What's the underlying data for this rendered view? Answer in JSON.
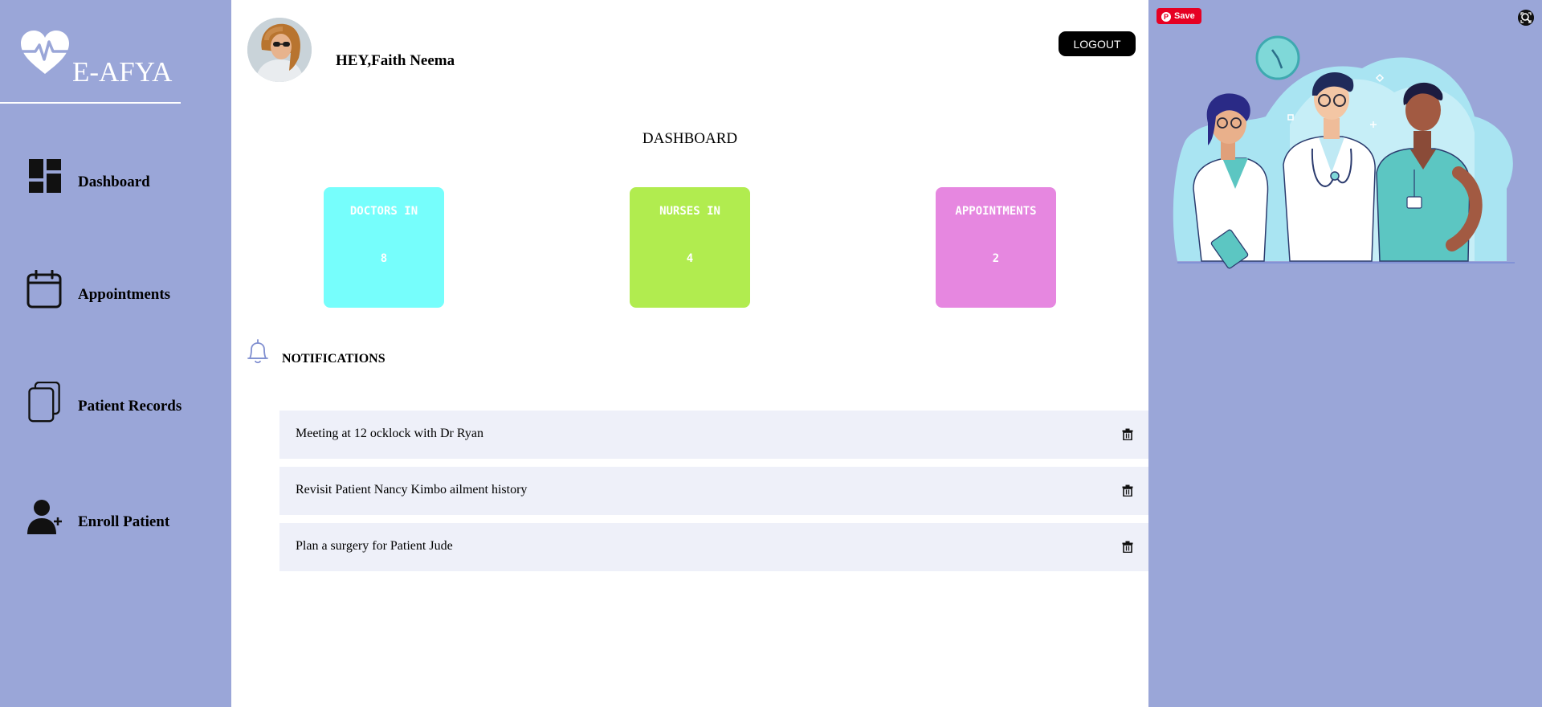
{
  "brand": {
    "name": "E-AFYA"
  },
  "sidebar": {
    "items": [
      {
        "label": "Dashboard",
        "icon": "dashboard-icon"
      },
      {
        "label": "Appointments",
        "icon": "calendar-icon"
      },
      {
        "label": "Patient Records",
        "icon": "records-icon"
      },
      {
        "label": "Enroll Patient",
        "icon": "add-user-icon"
      }
    ]
  },
  "header": {
    "greeting": "HEY,Faith Neema",
    "logout_label": "LOGOUT"
  },
  "dashboard": {
    "title": "DASHBOARD",
    "stats": [
      {
        "label": "DOCTORS IN",
        "value": "8",
        "color": "#76fefc"
      },
      {
        "label": "NURSES IN",
        "value": "4",
        "color": "#b1ec4f"
      },
      {
        "label": "APPOINTMENTS",
        "value": "2",
        "color": "#e687e0"
      }
    ]
  },
  "notifications": {
    "title": "NOTIFICATIONS",
    "items": [
      {
        "text": "Meeting at 12 ocklock with Dr Ryan"
      },
      {
        "text": "Revisit Patient Nancy Kimbo ailment history"
      },
      {
        "text": "Plan a surgery for Patient Jude"
      }
    ]
  },
  "right_panel": {
    "save_label": "Save"
  },
  "colors": {
    "sidebar_bg": "#9aa6d8",
    "notification_bg": "#eef0f9",
    "logout_bg": "#000000",
    "pinterest_red": "#e60023"
  }
}
